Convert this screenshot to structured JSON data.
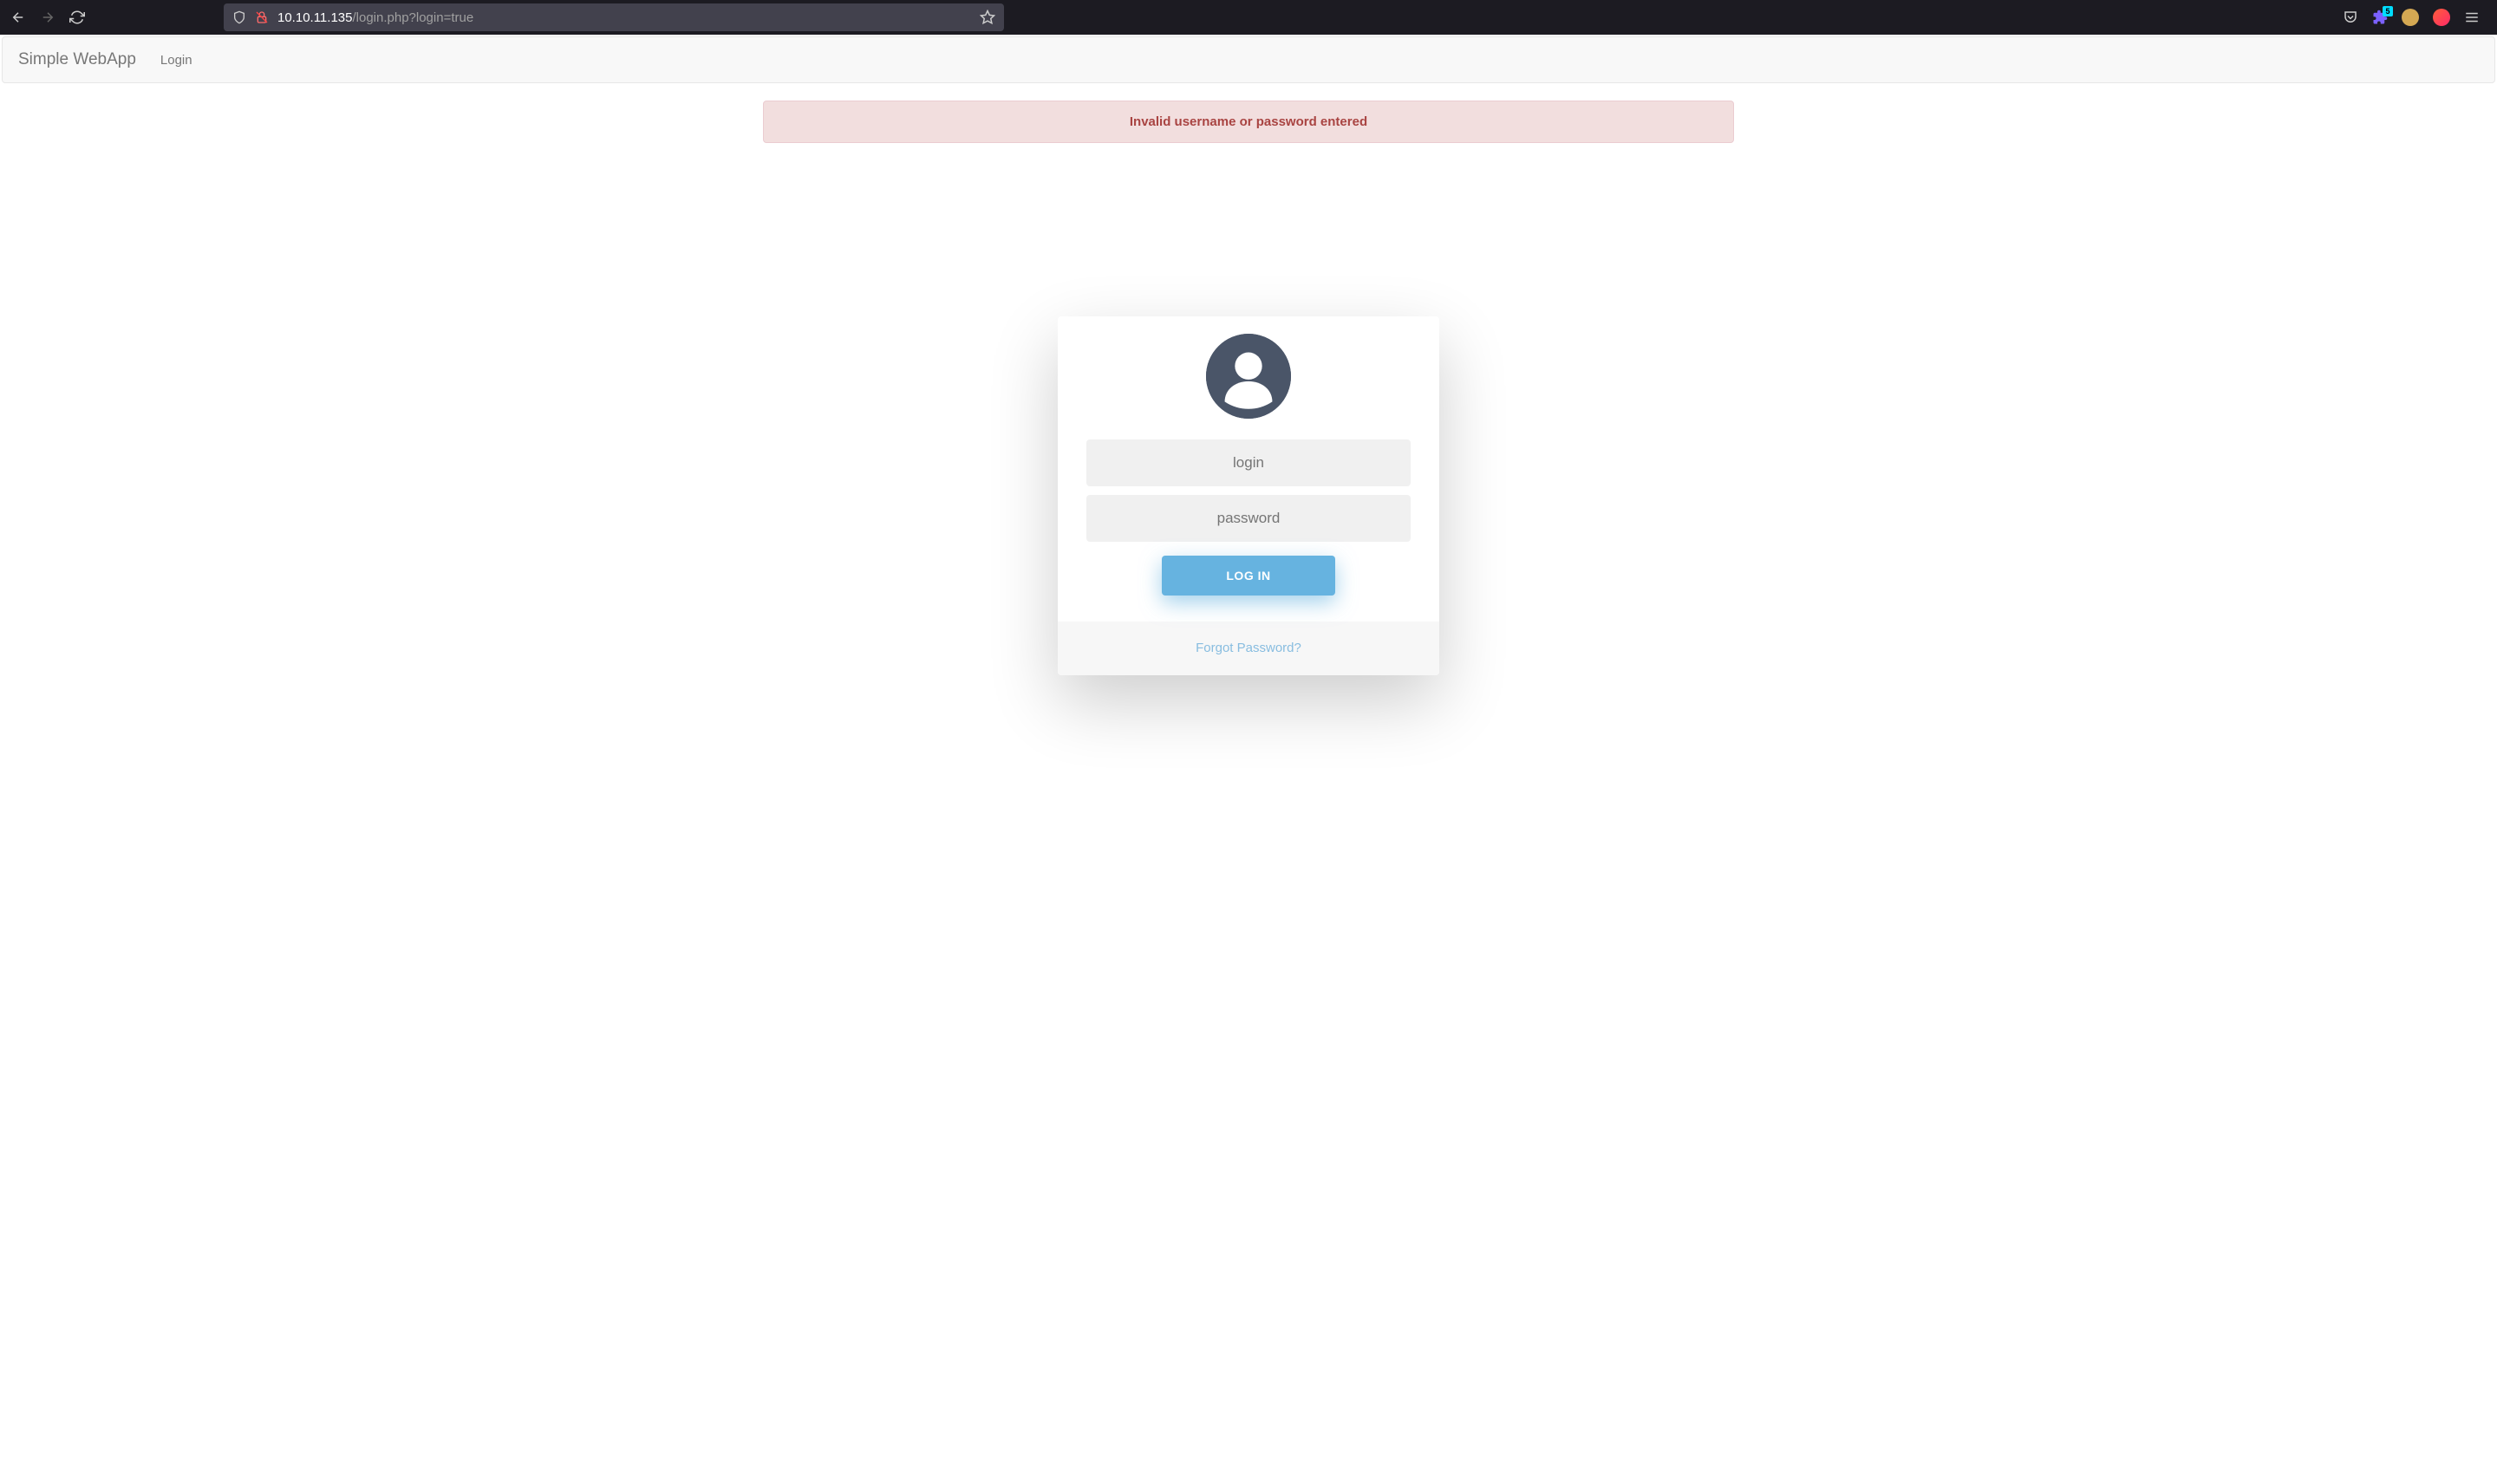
{
  "browser": {
    "url_host": "10.10.11.135",
    "url_path": "/login.php?login=true",
    "ext_badge": "5"
  },
  "nav": {
    "brand": "Simple WebApp",
    "links": [
      {
        "label": "Login"
      }
    ]
  },
  "alert": {
    "message": "Invalid username or password entered"
  },
  "login": {
    "username_placeholder": "login",
    "password_placeholder": "password",
    "submit_label": "LOG IN",
    "forgot_label": "Forgot Password?"
  }
}
